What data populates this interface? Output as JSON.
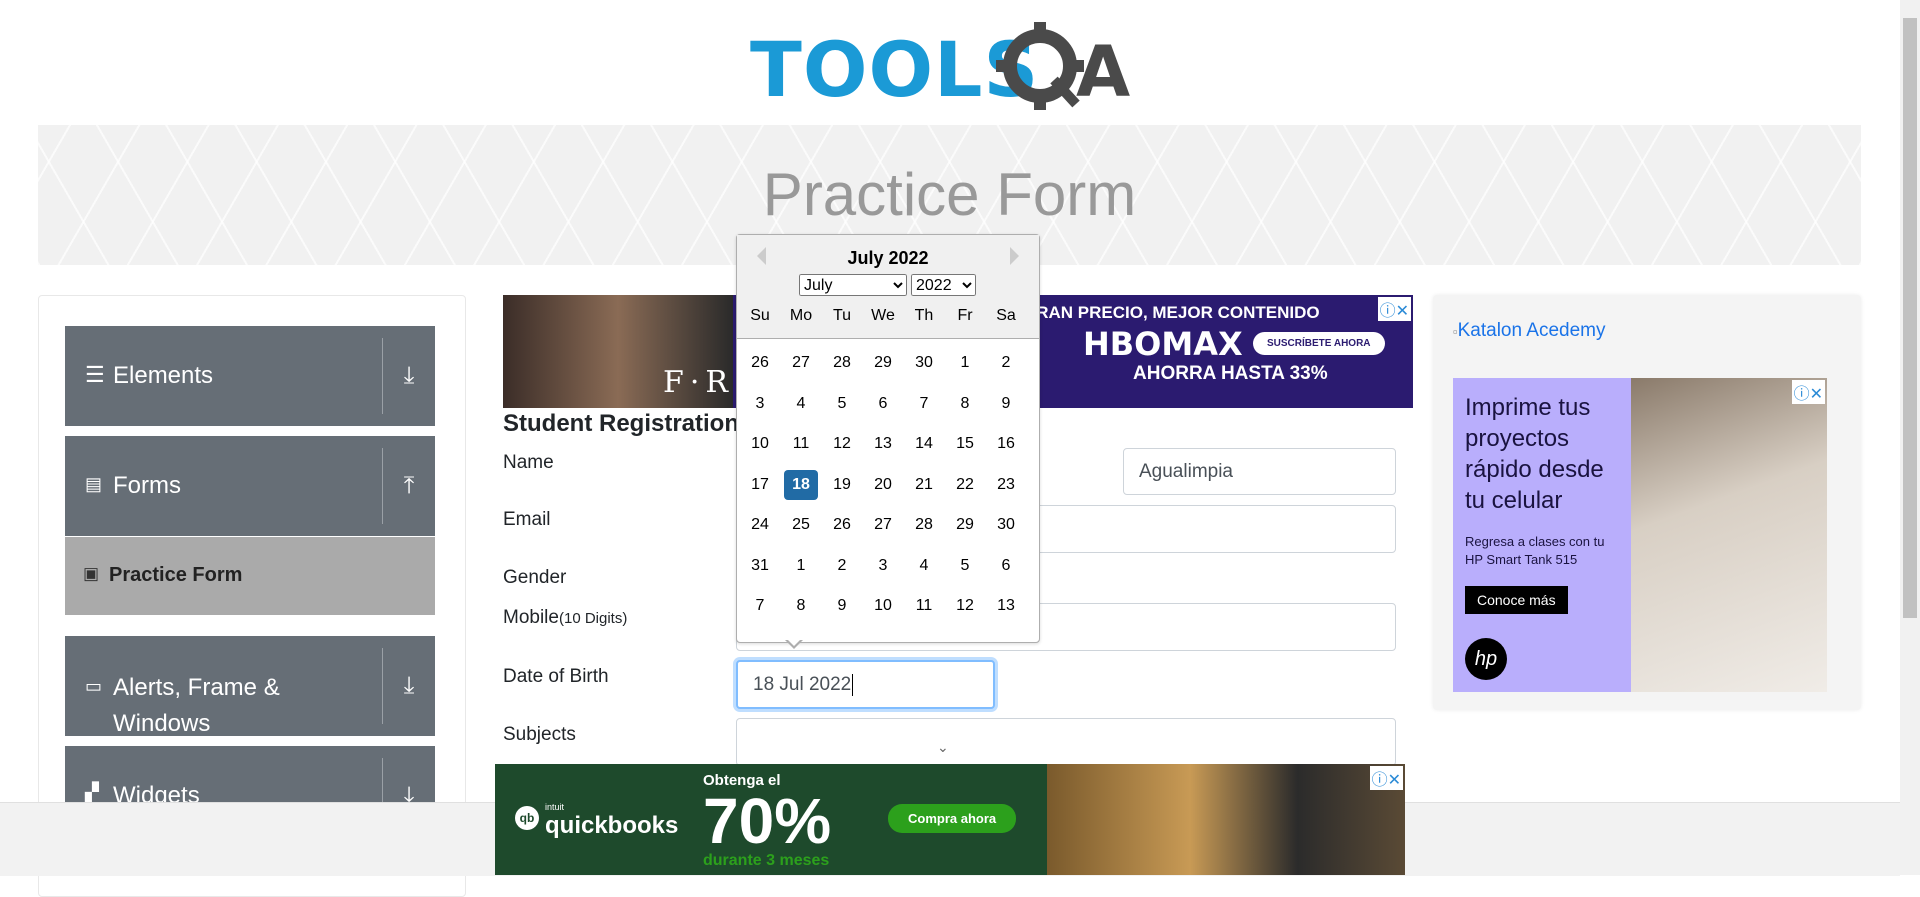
{
  "header": {
    "logo_text": "TOOLSQA",
    "page_title": "Practice Form"
  },
  "sidebar": {
    "groups": [
      {
        "label": "Elements",
        "icon": "hamburger-icon",
        "arrow": "download-icon"
      },
      {
        "label": "Forms",
        "icon": "document-icon",
        "arrow": "upload-icon"
      },
      {
        "label": "Alerts, Frame & Windows",
        "icon": "window-icon",
        "arrow": "download-icon"
      },
      {
        "label": "Widgets",
        "icon": "widgets-icon",
        "arrow": "download-icon"
      }
    ],
    "active_item": "Practice Form"
  },
  "form": {
    "heading": "Student Registration Form",
    "name_label": "Name",
    "last_name_value": "Agualimpia",
    "email_label": "Email",
    "gender_label": "Gender",
    "mobile_label": "Mobile",
    "mobile_hint": "(10 Digits)",
    "dob_label": "Date of Birth",
    "dob_value": "18 Jul 2022",
    "subjects_label": "Subjects"
  },
  "calendar": {
    "title": "July 2022",
    "month_select": "July",
    "year_select": "2022",
    "day_names": [
      "Su",
      "Mo",
      "Tu",
      "We",
      "Th",
      "Fr",
      "Sa"
    ],
    "weeks": [
      [
        "26",
        "27",
        "28",
        "29",
        "30",
        "1",
        "2"
      ],
      [
        "3",
        "4",
        "5",
        "6",
        "7",
        "8",
        "9"
      ],
      [
        "10",
        "11",
        "12",
        "13",
        "14",
        "15",
        "16"
      ],
      [
        "17",
        "18",
        "19",
        "20",
        "21",
        "22",
        "23"
      ],
      [
        "24",
        "25",
        "26",
        "27",
        "28",
        "29",
        "30"
      ],
      [
        "31",
        "1",
        "2",
        "3",
        "4",
        "5",
        "6"
      ],
      [
        "7",
        "8",
        "9",
        "10",
        "11",
        "12",
        "13"
      ]
    ],
    "selected": "18",
    "selected_color": "#216ba5"
  },
  "ads": {
    "top": {
      "line1": "GRAN PRECIO, MEJOR CONTENIDO",
      "brand": "HBOMAX",
      "cta": "SUSCRÍBETE AHORA",
      "offer": "AHORRA HASTA 33%"
    },
    "side": {
      "katalon": "Katalon Acedemy",
      "headline": "Imprime tus proyectos rápido desde tu celular",
      "sub": "Regresa a clases con tu HP Smart Tank 515",
      "cta": "Conoce más",
      "brand": "hp"
    },
    "bottom": {
      "brand": "quickbooks",
      "brand_prefix": "intuit",
      "line1": "Obtenga el",
      "big": "70%",
      "line2": "durante 3 meses",
      "cta": "Compra ahora"
    }
  },
  "colors": {
    "sidebar_group": "#666e76",
    "active_item": "#aaaaaa",
    "logo": "#1b9ad6"
  }
}
